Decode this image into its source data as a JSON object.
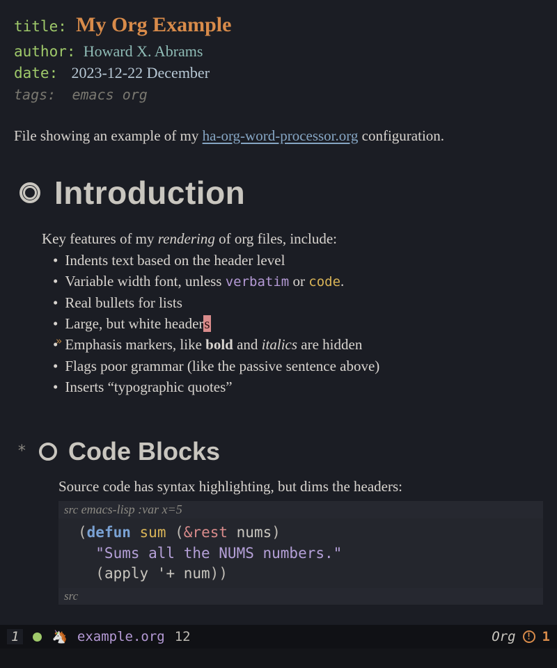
{
  "meta": {
    "title_key": "title",
    "title": "My Org Example",
    "author_key": "author",
    "author": "Howard X. Abrams",
    "date_key": "date",
    "date": "2023-12-22 December",
    "tags_key": "tags:",
    "tags": "emacs org"
  },
  "intro": {
    "para_pre": "File showing an example of my ",
    "link_text": "ha-org-word-processor.org",
    "para_post": " configuration."
  },
  "sections": {
    "introduction": {
      "heading": "Introduction",
      "lead_pre": "Key features of my ",
      "lead_em": "rendering",
      "lead_post": " of org files, include:",
      "bullets": {
        "b0": "Indents text based on the header level",
        "b1_pre": "Variable width font, unless ",
        "b1_verbatim": "verbatim",
        "b1_mid": " or ",
        "b1_code": "code",
        "b1_post": ".",
        "b2": "Real bullets for lists",
        "b3_pre": "Large, but white header",
        "b3_cursor": "s",
        "b4_pre": "Emphasis markers, like ",
        "b4_bold": "bold",
        "b4_mid": " and ",
        "b4_italic": "italics",
        "b4_post": " are hidden",
        "b5": "Flags poor grammar (like the passive sentence above)",
        "b6": "Inserts “typographic quotes”"
      }
    },
    "code_blocks": {
      "star": "*",
      "heading": "Code Blocks",
      "lead": "Source code has syntax highlighting, but dims the headers:",
      "src_begin_kw": "src",
      "src_begin_rest": " emacs-lisp :var x=5",
      "code": {
        "l1_open": "(",
        "l1_defun": "defun",
        "l1_sp1": " ",
        "l1_fn": "sum",
        "l1_sp2": " ",
        "l1_po": "(",
        "l1_amp": "&rest",
        "l1_sp3": " ",
        "l1_var": "nums",
        "l1_pc": ")",
        "l2_str": "\"Sums all the NUMS numbers.\"",
        "l3_open": "(",
        "l3_apply": "apply ",
        "l3_quote": "'+ ",
        "l3_num": "num",
        "l3_close": "))"
      },
      "src_end": "src"
    }
  },
  "modeline": {
    "winnum": "1",
    "horse": "🦄",
    "filename": "example.org",
    "linenum": "12",
    "mode": "Org",
    "warn_bang": "!",
    "warn_count": "1"
  }
}
